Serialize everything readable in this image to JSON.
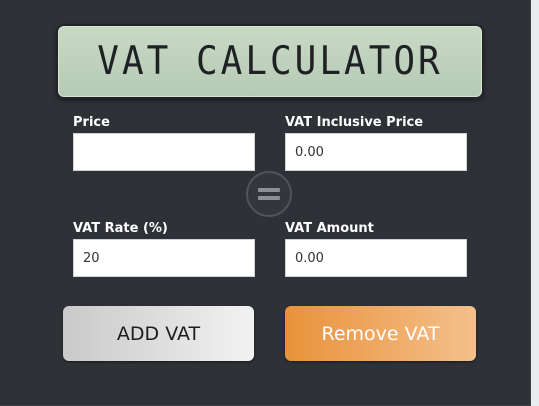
{
  "display": {
    "title": "VAT CALCULATOR"
  },
  "fields": {
    "price": {
      "label": "Price",
      "value": ""
    },
    "vat_inclusive_price": {
      "label": "VAT Inclusive Price",
      "value": "0.00"
    },
    "vat_rate": {
      "label": "VAT Rate (%)",
      "value": "20"
    },
    "vat_amount": {
      "label": "VAT Amount",
      "value": "0.00"
    }
  },
  "buttons": {
    "add_vat": "ADD VAT",
    "remove_vat": "Remove VAT"
  },
  "icons": {
    "equals": "equals-icon"
  },
  "colors": {
    "panel_background": "#2e3136",
    "display_green": "#c1d3bf",
    "add_button": "#d9d9d9",
    "remove_button": "#ec9f4d"
  }
}
